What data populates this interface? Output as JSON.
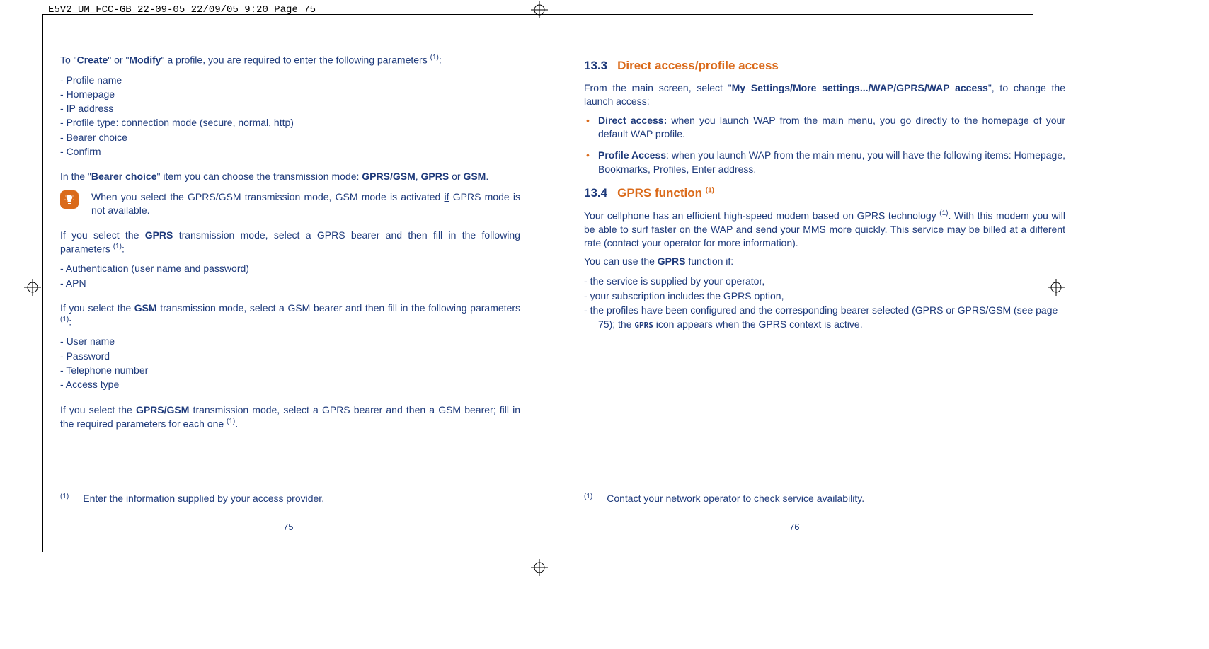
{
  "header": "E5V2_UM_FCC-GB_22-09-05  22/09/05  9:20  Page 75",
  "left": {
    "intro_pre": "To \"",
    "intro_create": "Create",
    "intro_mid": "\" or \"",
    "intro_modify": "Modify",
    "intro_post": "\" a profile, you are required to enter the following parameters ",
    "intro_sup": "(1)",
    "intro_tail": ":",
    "params": [
      "Profile name",
      "Homepage",
      "IP address",
      "Profile type: connection mode (secure, normal, http)",
      "Bearer choice",
      "Confirm"
    ],
    "bearer_pre": "In the \"",
    "bearer_bold": "Bearer choice",
    "bearer_mid": "\" item you can choose the transmission mode: ",
    "bearer_opt1": "GPRS/GSM",
    "bearer_sep": ", ",
    "bearer_opt2": "GPRS",
    "bearer_or": " or ",
    "bearer_opt3": "GSM",
    "bearer_tail": ".",
    "tip_pre": "When you select the GPRS/GSM transmission mode, GSM mode is activated ",
    "tip_if": "if",
    "tip_post": " GPRS mode is not available.",
    "gprs_intro_pre": "If you select the ",
    "gprs_bold": "GPRS",
    "gprs_intro_mid": " transmission mode, select a GPRS bearer and then fill in the following parameters ",
    "gprs_sup": "(1)",
    "gprs_tail": ":",
    "gprs_params": [
      "Authentication (user name and password)",
      "APN"
    ],
    "gsm_intro_pre": "If you select the ",
    "gsm_bold": "GSM",
    "gsm_intro_mid": " transmission mode, select a GSM bearer and then fill in the following parameters ",
    "gsm_sup": "(1)",
    "gsm_tail": ":",
    "gsm_params": [
      "User name",
      "Password",
      "Telephone number",
      "Access type"
    ],
    "both_pre": "If you select the ",
    "both_bold": "GPRS/GSM",
    "both_post": " transmission mode, select a GPRS bearer and then a GSM bearer; fill in the required parameters for each one ",
    "both_sup": "(1)",
    "both_tail": ".",
    "footnote_sup": "(1)",
    "footnote": "Enter the information supplied by your access provider.",
    "page_num": "75"
  },
  "right": {
    "sec1_num": "13.3",
    "sec1_title": "Direct access/profile access",
    "sec1_intro_pre": "From the main screen, select \"",
    "sec1_intro_bold": "My Settings/More settings.../WAP/GPRS/WAP access",
    "sec1_intro_post": "\", to change the launch access:",
    "bullets": {
      "b1_bold": "Direct access:",
      "b1_text": " when you launch WAP from the main menu, you go directly to the homepage of your default WAP profile.",
      "b2_bold": "Profile Access",
      "b2_text": ": when you launch WAP from the main menu, you will have the following items: Homepage, Bookmarks, Profiles, Enter address."
    },
    "sec2_num": "13.4",
    "sec2_title_pre": "GPRS function ",
    "sec2_sup": "(1)",
    "sec2_para_pre": "Your cellphone has an efficient high-speed modem based on GPRS technology ",
    "sec2_para_sup": "(1)",
    "sec2_para_post": ". With this modem you will be able to surf faster on the WAP and send your MMS more quickly. This service may be billed at a different rate (contact your operator for more information).",
    "sec2_use_pre": "You can use the ",
    "sec2_use_bold": "GPRS",
    "sec2_use_post": " function if:",
    "use_params": [
      "the service is supplied by your operator,",
      "your subscription includes the GPRS option,"
    ],
    "use_param3_pre": "the profiles have been configured and the corresponding bearer selected (GPRS or GPRS/GSM (see page 75); the ",
    "use_param3_icon": "GPRS",
    "use_param3_post": " icon appears when the GPRS context is active.",
    "footnote_sup": "(1)",
    "footnote": "Contact your network operator to check service availability.",
    "page_num": "76"
  }
}
